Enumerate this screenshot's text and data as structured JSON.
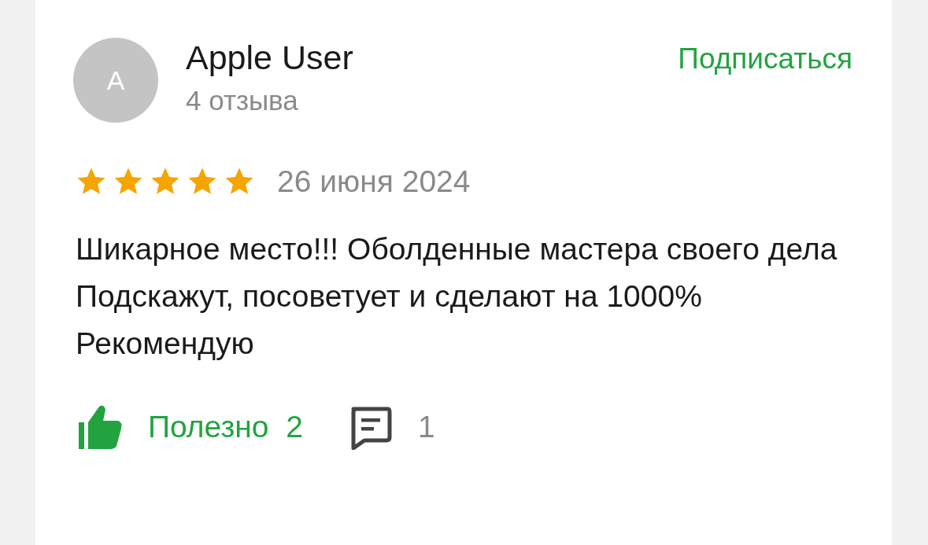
{
  "review": {
    "author": {
      "avatar_letter": "A",
      "name": "Apple User",
      "reviews_count": "4 отзыва"
    },
    "subscribe": "Подписаться",
    "stars": 5,
    "date": "26 июня 2024",
    "text": "Шикарное место!!! Оболденные мастера своего дела\nПодскажут, посоветует и сделают на 1000%\nРекомендую",
    "helpful": {
      "label": "Полезно",
      "count": "2",
      "selected": true
    },
    "comments": {
      "count": "1"
    }
  }
}
